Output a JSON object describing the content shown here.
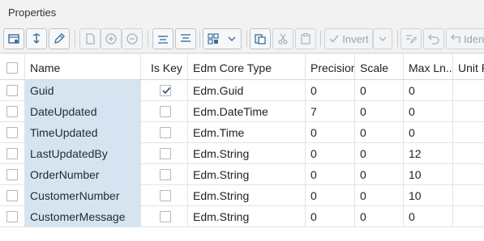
{
  "window": {
    "title": "Properties"
  },
  "toolbar": {
    "invert_label": "Invert",
    "ident_label": "Iden"
  },
  "table": {
    "columns": [
      "Name",
      "Is Key",
      "Edm Core Type",
      "Precision",
      "Scale",
      "Max Ln...",
      "Unit P"
    ],
    "rows": [
      {
        "name": "Guid",
        "is_key": true,
        "type": "Edm.Guid",
        "precision": "0",
        "scale": "0",
        "max_len": "0"
      },
      {
        "name": "DateUpdated",
        "is_key": false,
        "type": "Edm.DateTime",
        "precision": "7",
        "scale": "0",
        "max_len": "0"
      },
      {
        "name": "TimeUpdated",
        "is_key": false,
        "type": "Edm.Time",
        "precision": "0",
        "scale": "0",
        "max_len": "0"
      },
      {
        "name": "LastUpdatedBy",
        "is_key": false,
        "type": "Edm.String",
        "precision": "0",
        "scale": "0",
        "max_len": "12"
      },
      {
        "name": "OrderNumber",
        "is_key": false,
        "type": "Edm.String",
        "precision": "0",
        "scale": "0",
        "max_len": "10"
      },
      {
        "name": "CustomerNumber",
        "is_key": false,
        "type": "Edm.String",
        "precision": "0",
        "scale": "0",
        "max_len": "10"
      },
      {
        "name": "CustomerMessage",
        "is_key": false,
        "type": "Edm.String",
        "precision": "0",
        "scale": "0",
        "max_len": "0"
      }
    ]
  },
  "icons": [
    "table-settings-icon",
    "change-icon",
    "edit-icon",
    "new-document-icon",
    "add-icon",
    "remove-icon",
    "align-top-icon",
    "align-bottom-icon",
    "grid-menu-icon",
    "chevron-down-icon",
    "copy-icon",
    "cut-icon",
    "paste-icon",
    "check-icon",
    "chevron-down-icon",
    "pencil-list-icon",
    "undo-icon",
    "ident-icon"
  ]
}
